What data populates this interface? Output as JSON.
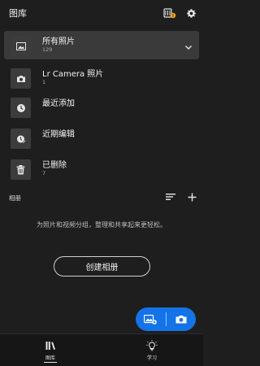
{
  "header": {
    "title": "图库",
    "icons": [
      "cloud-sync-icon",
      "gear-icon"
    ],
    "badge_color": "#f5a623"
  },
  "albums": [
    {
      "label": "所有照片",
      "count": "129",
      "icon": "photo-icon",
      "selected": true
    },
    {
      "label": "Lr Camera 照片",
      "count": "1",
      "icon": "camera-icon"
    },
    {
      "label": "最近添加",
      "count": "",
      "icon": "clock-icon"
    },
    {
      "label": "近期编辑",
      "count": "",
      "icon": "edit-icon"
    },
    {
      "label": "已删除",
      "count": "7",
      "icon": "trash-icon"
    }
  ],
  "section": {
    "title": "相册",
    "icons": [
      "sort-icon",
      "plus-icon"
    ]
  },
  "empty_state": {
    "text": "为照片和视频分组，整理和共享起来更轻松。",
    "button_label": "创建相册"
  },
  "fab": {
    "color": "#1473e6",
    "icons": [
      "add-photos-icon",
      "camera-icon"
    ]
  },
  "bottom_nav": [
    {
      "label": "图库",
      "icon": "library-icon",
      "active": true
    },
    {
      "label": "学习",
      "icon": "lightbulb-icon",
      "active": false
    }
  ]
}
